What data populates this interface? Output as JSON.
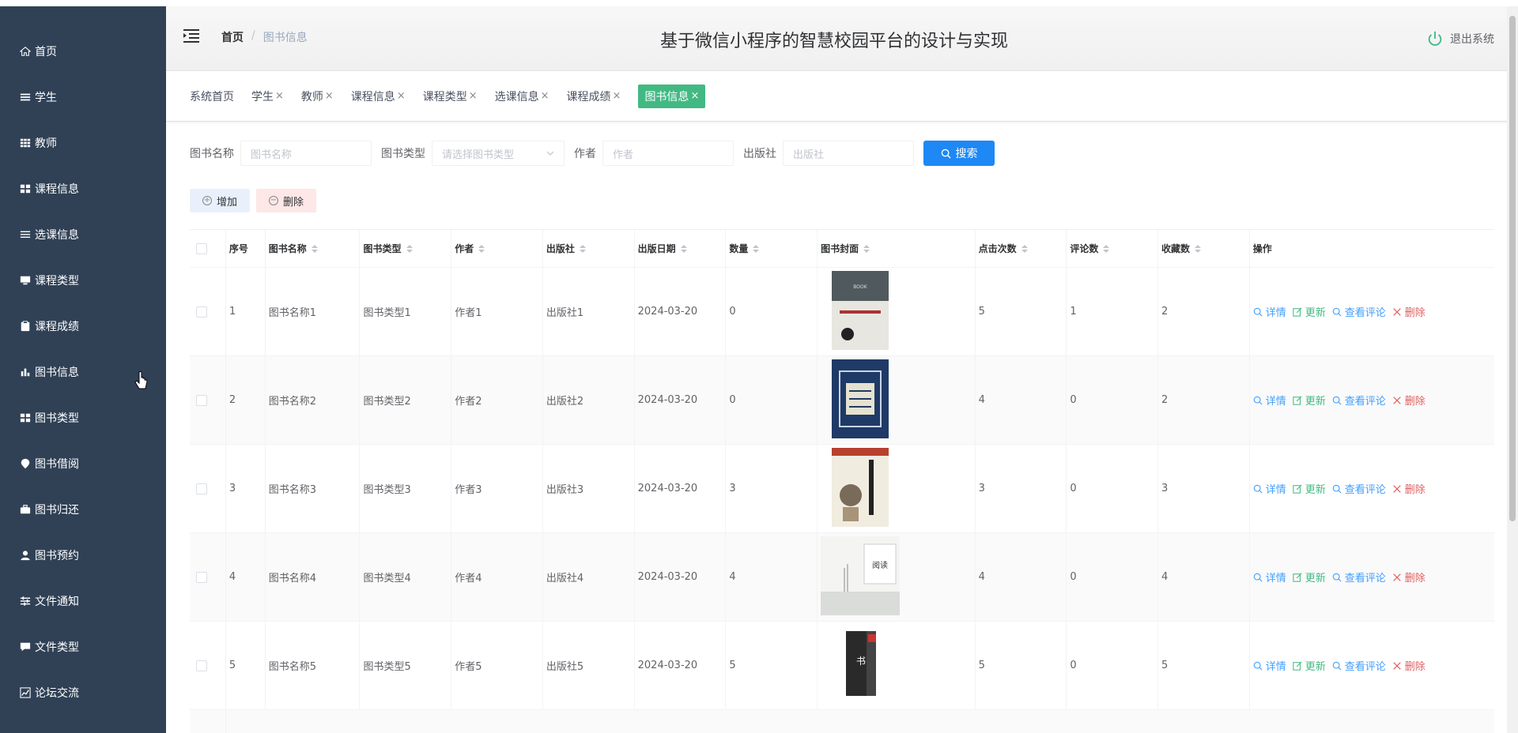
{
  "sidebar": {
    "items": [
      {
        "label": "首页",
        "icon": "home-icon"
      },
      {
        "label": "学生",
        "icon": "list-icon"
      },
      {
        "label": "教师",
        "icon": "grid-icon"
      },
      {
        "label": "课程信息",
        "icon": "apps-icon"
      },
      {
        "label": "选课信息",
        "icon": "menu-icon"
      },
      {
        "label": "课程类型",
        "icon": "monitor-icon"
      },
      {
        "label": "课程成绩",
        "icon": "clipboard-icon"
      },
      {
        "label": "图书信息",
        "icon": "bar-chart-icon"
      },
      {
        "label": "图书类型",
        "icon": "apps-icon"
      },
      {
        "label": "图书借阅",
        "icon": "location-icon"
      },
      {
        "label": "图书归还",
        "icon": "briefcase-icon"
      },
      {
        "label": "图书预约",
        "icon": "user-icon"
      },
      {
        "label": "文件通知",
        "icon": "sliders-icon"
      },
      {
        "label": "文件类型",
        "icon": "chat-icon"
      },
      {
        "label": "论坛交流",
        "icon": "line-chart-icon"
      }
    ]
  },
  "header": {
    "breadcrumb_home": "首页",
    "breadcrumb_sep": "/",
    "breadcrumb_current": "图书信息",
    "title": "基于微信小程序的智慧校园平台的设计与实现",
    "logout": "退出系统"
  },
  "tags": [
    {
      "label": "系统首页",
      "closable": false
    },
    {
      "label": "学生",
      "closable": true
    },
    {
      "label": "教师",
      "closable": true
    },
    {
      "label": "课程信息",
      "closable": true
    },
    {
      "label": "课程类型",
      "closable": true
    },
    {
      "label": "选课信息",
      "closable": true
    },
    {
      "label": "课程成绩",
      "closable": true
    },
    {
      "label": "图书信息",
      "closable": true,
      "active": true
    }
  ],
  "search": {
    "name_label": "图书名称",
    "name_placeholder": "图书名称",
    "type_label": "图书类型",
    "type_placeholder": "请选择图书类型",
    "author_label": "作者",
    "author_placeholder": "作者",
    "publisher_label": "出版社",
    "publisher_placeholder": "出版社",
    "search_button": "搜索"
  },
  "actions": {
    "add": "增加",
    "delete": "删除"
  },
  "table": {
    "columns": [
      "序号",
      "图书名称",
      "图书类型",
      "作者",
      "出版社",
      "出版日期",
      "数量",
      "图书封面",
      "点击次数",
      "评论数",
      "收藏数",
      "操作"
    ],
    "rows": [
      {
        "index": "1",
        "name": "图书名称1",
        "type": "图书类型1",
        "author": "作者1",
        "publisher": "出版社1",
        "date": "2024-03-20",
        "qty": "0",
        "clicks": "5",
        "comments": "1",
        "favorites": "2"
      },
      {
        "index": "2",
        "name": "图书名称2",
        "type": "图书类型2",
        "author": "作者2",
        "publisher": "出版社2",
        "date": "2024-03-20",
        "qty": "0",
        "clicks": "4",
        "comments": "0",
        "favorites": "2"
      },
      {
        "index": "3",
        "name": "图书名称3",
        "type": "图书类型3",
        "author": "作者3",
        "publisher": "出版社3",
        "date": "2024-03-20",
        "qty": "3",
        "clicks": "3",
        "comments": "0",
        "favorites": "3"
      },
      {
        "index": "4",
        "name": "图书名称4",
        "type": "图书类型4",
        "author": "作者4",
        "publisher": "出版社4",
        "date": "2024-03-20",
        "qty": "4",
        "clicks": "4",
        "comments": "0",
        "favorites": "4"
      },
      {
        "index": "5",
        "name": "图书名称5",
        "type": "图书类型5",
        "author": "作者5",
        "publisher": "出版社5",
        "date": "2024-03-20",
        "qty": "5",
        "clicks": "5",
        "comments": "0",
        "favorites": "5"
      }
    ],
    "ops": {
      "detail": "详情",
      "update": "更新",
      "review": "查看评论",
      "delete": "删除"
    }
  },
  "colors": {
    "sidebar_bg": "#304156",
    "active_tag": "#42b983",
    "primary": "#1e88f5"
  }
}
